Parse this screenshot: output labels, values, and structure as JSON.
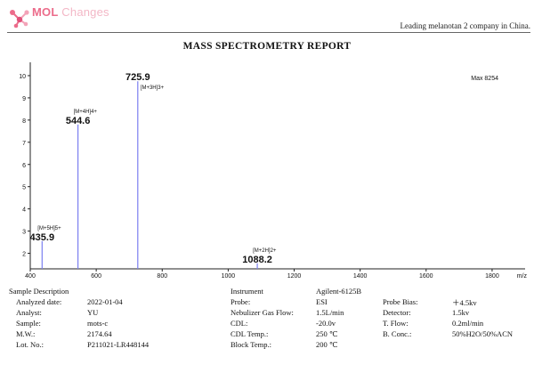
{
  "header": {
    "brand_main": "MOL",
    "brand_rest": " Changes",
    "tagline": "Leading melanotan 2 company in China.",
    "title": "MASS SPECTROMETRY REPORT"
  },
  "colors": {
    "brand": "#ec6c8b",
    "peak": "#7b7ff0",
    "axis": "#222222"
  },
  "chart_data": {
    "type": "bar",
    "corner_label": "Max 8254",
    "xlim": [
      400,
      1900
    ],
    "ylim": [
      1.3,
      10.6
    ],
    "x_ticks": [
      "400",
      "600",
      "800",
      "1000",
      "1200",
      "1400",
      "1600",
      "1800"
    ],
    "x_tick_values": [
      400,
      600,
      800,
      1000,
      1200,
      1400,
      1600,
      1800
    ],
    "x_unit": "m/z",
    "y_ticks": [
      "10",
      "9",
      "8",
      "7",
      "6",
      "5",
      "4",
      "3",
      "2"
    ],
    "y_tick_values": [
      10,
      9,
      8,
      7,
      6,
      5,
      4,
      3,
      2
    ],
    "peaks": [
      {
        "mz": 435.9,
        "intensity": 2.55,
        "label": "435.9",
        "ion": "[M+5H]5+"
      },
      {
        "mz": 544.6,
        "intensity": 7.8,
        "label": "544.6",
        "ion": "[M+4H]4+"
      },
      {
        "mz": 725.9,
        "intensity": 9.75,
        "label": "725.9",
        "ion": "[M+3H]3+"
      },
      {
        "mz": 1088.2,
        "intensity": 1.55,
        "label": "1088.2",
        "ion": "[M+2H]2+"
      }
    ]
  },
  "info": {
    "left": {
      "heading": "Sample Description",
      "rows": [
        {
          "label": "Analyzed date:",
          "value": "2022-01-04"
        },
        {
          "label": "Analyst:",
          "value": "YU"
        },
        {
          "label": "Sample:",
          "value": "mots-c"
        },
        {
          "label": "M.W.:",
          "value": "2174.64"
        },
        {
          "label": "Lot. No.:",
          "value": "P211021-LR448144"
        }
      ]
    },
    "middle": {
      "heading": "Instrument",
      "heading_value": "Agilent-6125B",
      "rows": [
        {
          "label": "Probe:",
          "value": "ESI"
        },
        {
          "label": "Nebulizer Gas Flow:",
          "value": "1.5L/min"
        },
        {
          "label": "CDL:",
          "value": "-20.0v"
        },
        {
          "label": "CDL Temp.:",
          "value": "250 ℃"
        },
        {
          "label": "Block Temp.:",
          "value": "200 ℃"
        }
      ]
    },
    "right": {
      "rows": [
        {
          "label": "Probe Bias:",
          "value": "＋4.5kv"
        },
        {
          "label": "Detector:",
          "value": "1.5kv"
        },
        {
          "label": "T. Flow:",
          "value": "0.2ml/min"
        },
        {
          "label": "B. Conc.:",
          "value": "50%H2O/50%ACN"
        }
      ]
    }
  }
}
